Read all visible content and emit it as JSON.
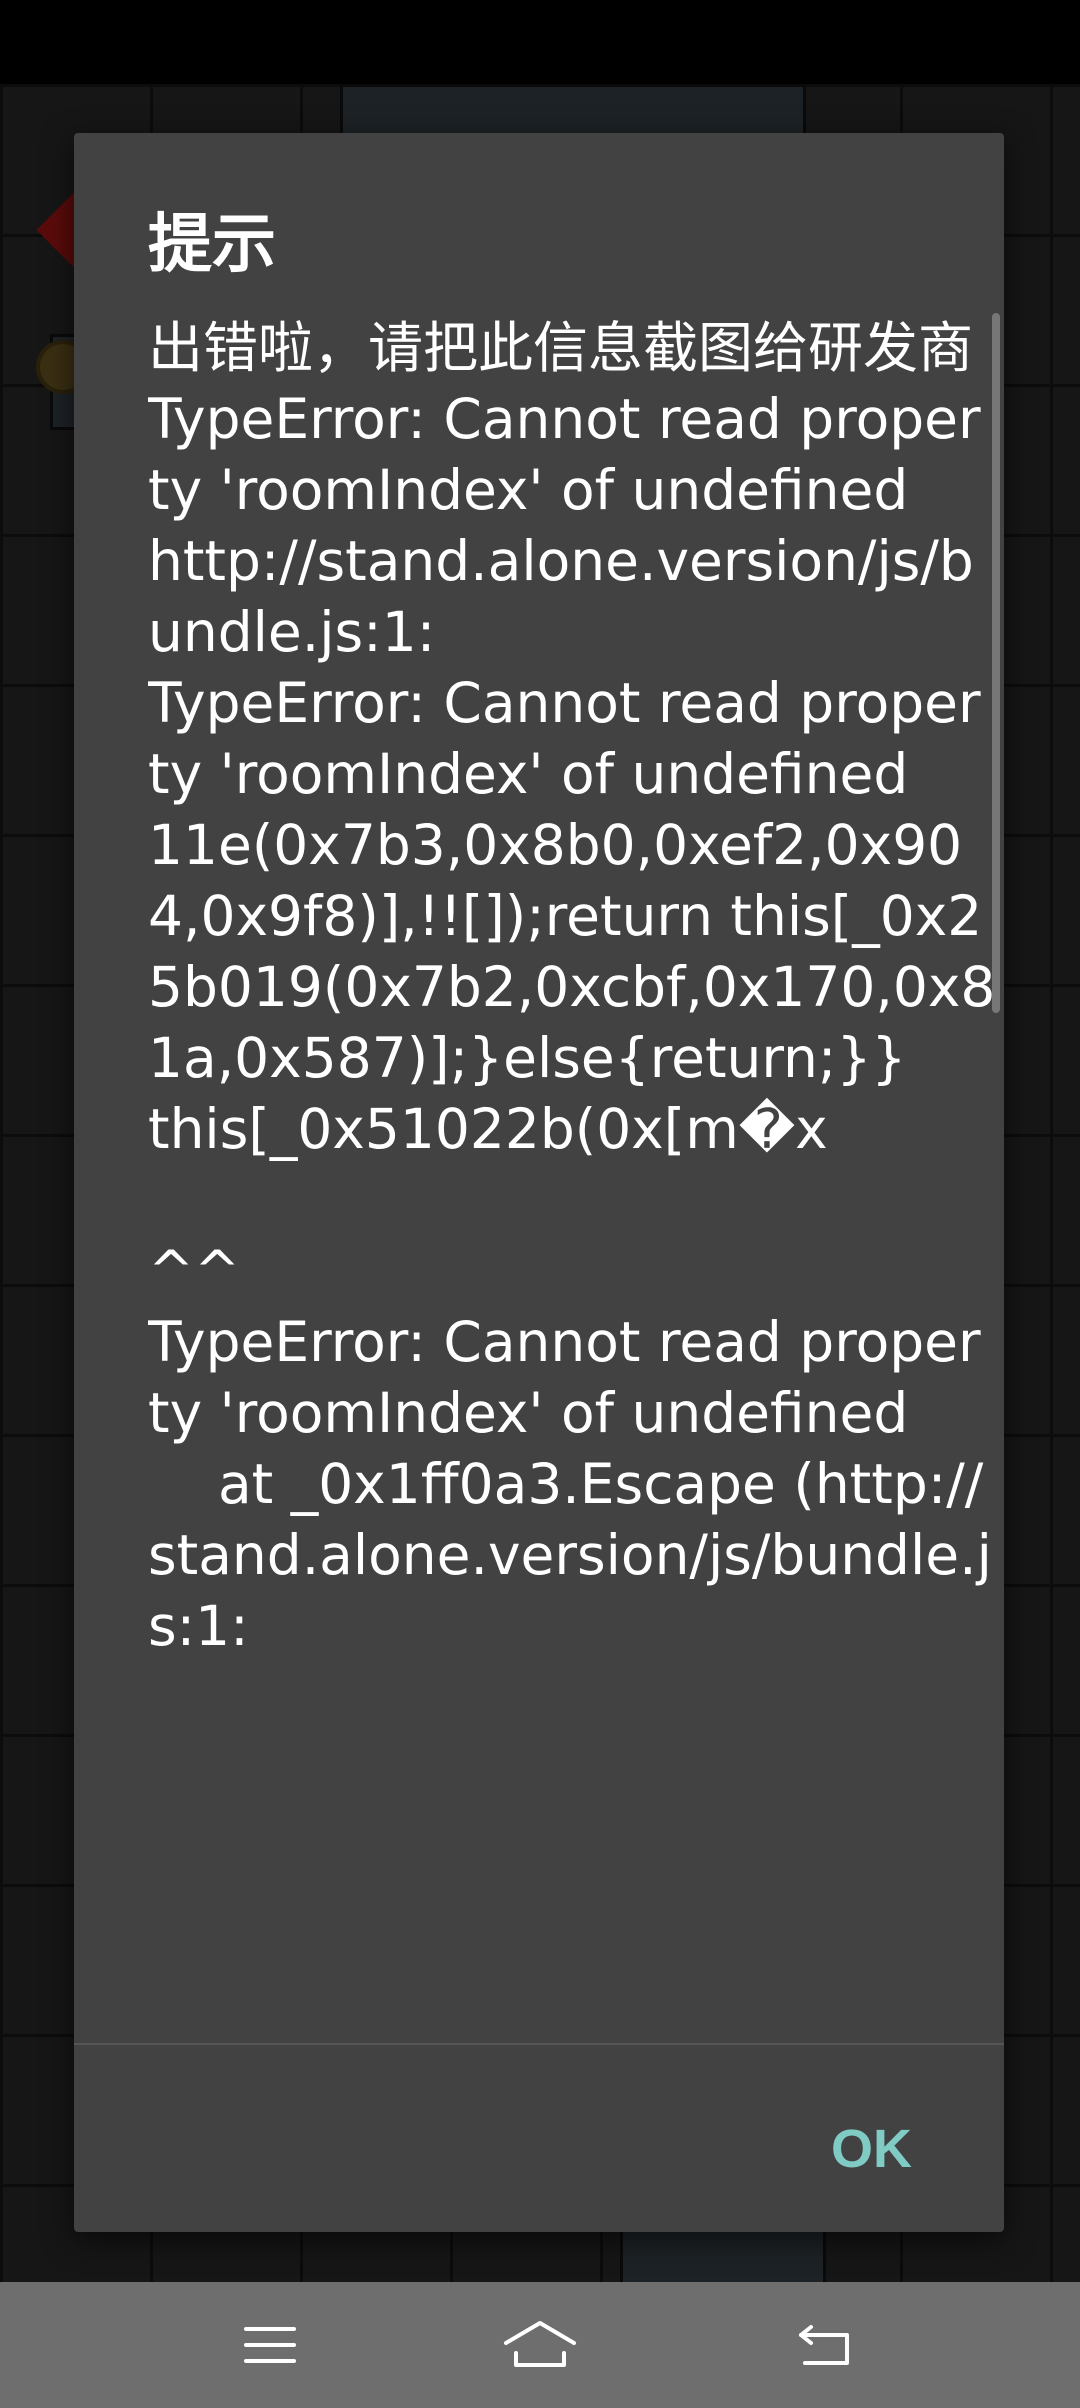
{
  "dialog": {
    "title": "提示",
    "message": "出错啦，请把此信息截图给研发商\nTypeError: Cannot read property 'roomIndex' of undefined\nhttp://stand.alone.version/js/bundle.js:1:\nTypeError: Cannot read property 'roomIndex' of undefined\n11e(0x7b3,0x8b0,0xef2,0x904,0x9f8)],!![]);return this[_0x25b019(0x7b2,0xcbf,0x170,0x81a,0x587)];}else{return;}}\nthis[_0x51022b(0x[m�x\n\n^^\nTypeError: Cannot read property 'roomIndex' of undefined\n    at _0x1ff0a3.Escape (http://stand.alone.version/js/bundle.js:1:",
    "ok_label": "OK",
    "ok_color": "#80cbc4",
    "background_color": "#424242"
  },
  "navbar": {
    "menu_icon": "menu-icon",
    "home_icon": "home-icon",
    "back_icon": "back-icon"
  }
}
